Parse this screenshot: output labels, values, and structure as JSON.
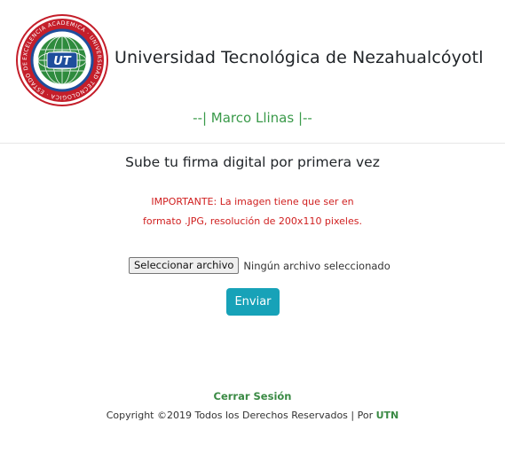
{
  "header": {
    "university_name": "Universidad Tecnológica de Nezahualcóyotl",
    "user_line": "--| Marco Llinas |--"
  },
  "logo": {
    "seal_text": "EXCELENCIA ACADEMICA · UNIVERSIDAD TECNOLOGICA · ESTADO DE MEXICO",
    "monogram": "UT",
    "colors": {
      "outer_ring": "#c41e2a",
      "inner_ring": "#1f4e9c",
      "globe": "#2e8b3d",
      "monogram": "#ffffff"
    }
  },
  "main": {
    "heading": "Sube tu firma digital por primera vez",
    "warning_line1": "IMPORTANTE: La imagen tiene que ser en",
    "warning_line2": "formato .JPG, resolución de 200x110 pixeles.",
    "file_button_label": "Seleccionar archivo",
    "file_status": "Ningún archivo seleccionado",
    "submit_label": "Enviar"
  },
  "footer": {
    "logout_label": "Cerrar Sesión",
    "copyright_prefix": "Copyright ©2019 Todos los Derechos Reservados | Por ",
    "brand": "UTN"
  },
  "colors": {
    "accent_green": "#3a9a4a",
    "warning_red": "#d01f1f",
    "button_teal": "#17a2b8"
  }
}
